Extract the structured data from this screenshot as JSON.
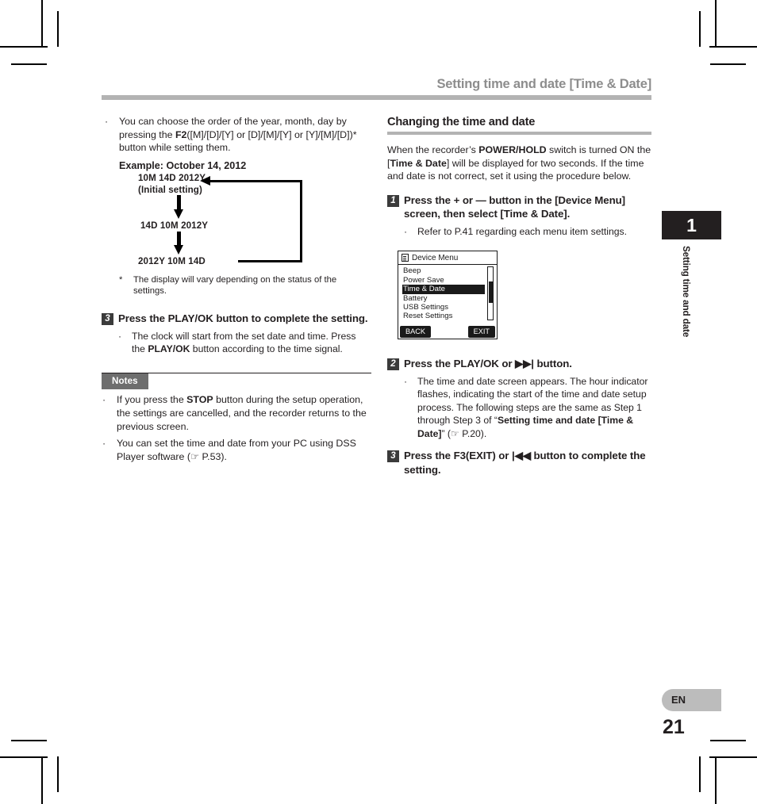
{
  "header": {
    "title": "Setting time and date [Time & Date]"
  },
  "left_column": {
    "bullet_order": {
      "dot": "·",
      "segments": "You can choose the order of the year, month, day by pressing the ",
      "bold1": "F2",
      "rest": "([M]/[D]/[Y] or [D]/[M]/[Y] or [Y]/[M]/[D])* button while setting them."
    },
    "example_title": "Example: October 14, 2012",
    "diagram": {
      "label_1_line1": "10M 14D 2012Y",
      "label_1_line2": "(Initial setting)",
      "label_2": "14D 10M 2012Y",
      "label_3": "2012Y 10M 14D"
    },
    "footnote": {
      "star": "*",
      "text": "The display will vary depending on the status of the settings."
    },
    "step3": {
      "number": "3",
      "text": "Press the PLAY/OK button to complete the setting.",
      "bullet_dot": "·",
      "bullet_text_a": "The clock will start from the set date and time. Press the ",
      "bullet_bold": "PLAY/OK",
      "bullet_text_b": " button according to the time signal."
    },
    "notes": {
      "badge": "Notes",
      "items": [
        {
          "dot": "·",
          "a": "If you press the ",
          "bold": "STOP",
          "b": " button during the setup operation, the settings are cancelled, and the recorder returns to the previous screen."
        },
        {
          "dot": "·",
          "a": "You can set the time and date from your PC using DSS Player software (",
          "bold": "☞",
          "b": " P.53)."
        }
      ]
    }
  },
  "right_column": {
    "section_heading": "Changing the time and date",
    "intro": {
      "a": "When the recorder’s ",
      "bold1": "POWER/HOLD",
      "b": " switch is turned ON the [",
      "bold2": "Time & Date",
      "c": "] will be displayed for two seconds. If the time and date is not correct, set it using the procedure below."
    },
    "step1": {
      "number": "1",
      "text": "Press the + or — button in the [Device Menu] screen, then select [Time & Date].",
      "bullet_dot": "·",
      "bullet_text": "Refer to P.41 regarding each menu item settings."
    },
    "step2": {
      "number": "2",
      "text_a": "Press the PLAY/OK or ",
      "glyph": "▶▶|",
      "text_b": " button.",
      "bullet_dot": "·",
      "bullet_a": "The time and date screen appears. The hour indicator flashes, indicating the start of the time and date setup process. The following steps are the same as Step 1 through Step 3 of “",
      "bullet_bold": "Setting time and date [Time & Date]",
      "bullet_b": "” (☞ P.20)."
    },
    "step3": {
      "number": "3",
      "text_a": "Press the F3(EXIT) or ",
      "glyph": "|◀◀",
      "text_b": " button to complete the setting."
    },
    "lcd": {
      "title": "Device Menu",
      "title_icon": "menu-list-icon",
      "items": [
        {
          "label": "Beep",
          "selected": false
        },
        {
          "label": "Power Save",
          "selected": false
        },
        {
          "label": "Time & Date",
          "selected": true
        },
        {
          "label": "Battery",
          "selected": false
        },
        {
          "label": "USB Settings",
          "selected": false
        },
        {
          "label": "Reset Settings",
          "selected": false
        }
      ],
      "softkey_left": "BACK",
      "softkey_right": "EXIT"
    }
  },
  "side_tab": {
    "number": "1",
    "label": "Setting time and date"
  },
  "footer": {
    "language": "EN",
    "page_number": "21"
  },
  "colors": {
    "header_gray": "#8d8d8d",
    "rule_gray": "#b3b3b3",
    "notes_badge_gray": "#6e6e6e",
    "step_box_gray": "#3b3b3b",
    "ink": "#231f20",
    "lang_badge_gray": "#bcbcbc"
  }
}
